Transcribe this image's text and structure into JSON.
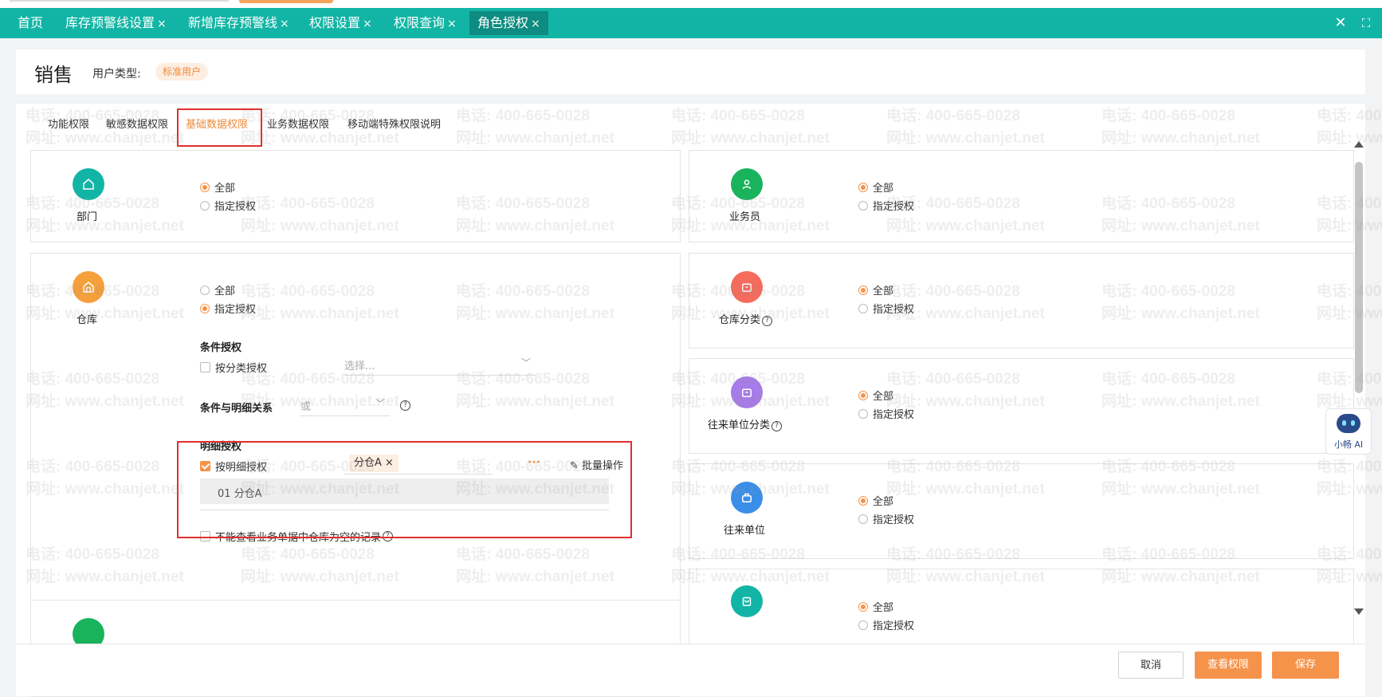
{
  "tabs": [
    {
      "label": "首页",
      "closable": false
    },
    {
      "label": "库存预警线设置",
      "closable": true
    },
    {
      "label": "新增库存预警线",
      "closable": true
    },
    {
      "label": "权限设置",
      "closable": true
    },
    {
      "label": "权限查询",
      "closable": true
    },
    {
      "label": "角色授权",
      "closable": true,
      "active": true
    }
  ],
  "tab_close_symbol": "×",
  "header": {
    "title": "销售",
    "user_type_label": "用户类型:",
    "user_type_value": "标准用户"
  },
  "subtabs": [
    "功能权限",
    "敏感数据权限",
    "基础数据权限",
    "业务数据权限",
    "移动端特殊权限说明"
  ],
  "active_subtab": "基础数据权限",
  "radio": {
    "all": "全部",
    "specified": "指定授权"
  },
  "entities": {
    "department": {
      "label": "部门",
      "icon": "home-icon",
      "color": "#12b5a5",
      "selected": "all"
    },
    "salesperson": {
      "label": "业务员",
      "icon": "person-icon",
      "color": "#19b35c",
      "selected": "all"
    },
    "warehouse": {
      "label": "仓库",
      "icon": "warehouse-icon",
      "color": "#f5a03a",
      "selected": "specified"
    },
    "warehouse_category": {
      "label": "仓库分类",
      "icon": "box-icon",
      "color": "#f56b5c",
      "selected": "all",
      "help": "?"
    },
    "partner_category": {
      "label": "往来单位分类",
      "icon": "box-icon",
      "color": "#a77be8",
      "selected": "all",
      "help": "?"
    },
    "partner": {
      "label": "往来单位",
      "icon": "briefcase-icon",
      "color": "#3b8ee8",
      "selected": "all"
    },
    "fifth_right": {
      "label": "",
      "icon": "bag-icon",
      "color": "#12b5a5",
      "selected": "all"
    }
  },
  "warehouse_conditions": {
    "cond_title": "条件授权",
    "by_category_label": "按分类授权",
    "by_category_checked": false,
    "category_placeholder": "选择...",
    "relation_label": "条件与明细关系",
    "relation_value": "或",
    "relation_help": "?",
    "detail_title": "明细授权",
    "by_detail_label": "按明细授权",
    "by_detail_checked": true,
    "selected_tag": "分仓A",
    "tag_close": "×",
    "more": "···",
    "batch_label": "批量操作",
    "detail_rows": [
      "01 分仓A"
    ],
    "empty_record_label": "不能查看业务单据中仓库为空的记录",
    "empty_record_checked": false,
    "empty_record_help": "?"
  },
  "buttons": {
    "cancel": "取消",
    "view": "查看权限",
    "save": "保存"
  },
  "assistant_label": "小畅 AI",
  "watermark": {
    "phone": "电话: 400-665-0028",
    "site": "网址: www.chanjet.net"
  },
  "colors": {
    "teal": "#12b5a5",
    "orange": "#f5934a",
    "highlight": "#e0302e"
  }
}
